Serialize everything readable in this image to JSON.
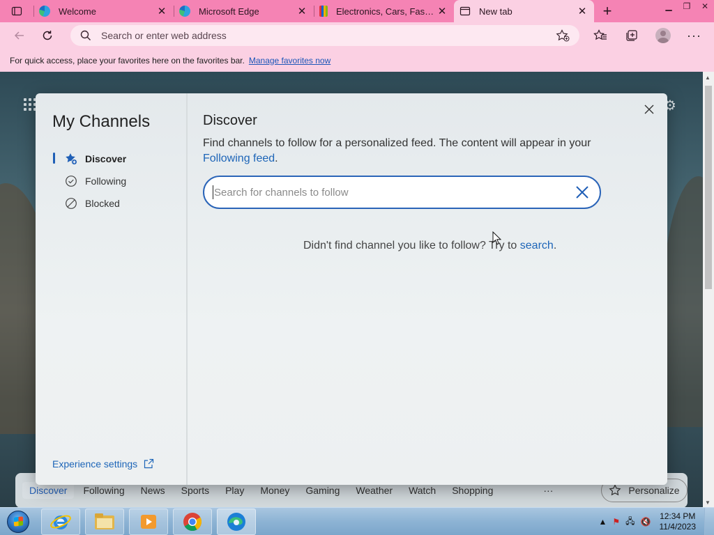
{
  "browser": {
    "tabs": [
      {
        "title": "Welcome",
        "icon": "edge-icon"
      },
      {
        "title": "Microsoft Edge",
        "icon": "edge-icon"
      },
      {
        "title": "Electronics, Cars, Fashion",
        "icon": "ebay-icon"
      },
      {
        "title": "New tab",
        "icon": "newtab-icon",
        "active": true
      }
    ],
    "address_placeholder": "Search or enter web address",
    "favorites_bar": {
      "message": "For quick access, place your favorites here on the favorites bar.",
      "link": "Manage favorites now"
    },
    "theme_color": "#f583b4"
  },
  "modal": {
    "title": "My Channels",
    "nav": [
      {
        "label": "Discover",
        "icon": "discover-star-icon",
        "active": true
      },
      {
        "label": "Following",
        "icon": "check-circle-icon"
      },
      {
        "label": "Blocked",
        "icon": "block-icon"
      }
    ],
    "experience_settings": "Experience settings",
    "heading": "Discover",
    "description": "Find channels to follow for a personalized feed. The content will appear in your",
    "description_link": "Following feed",
    "description_end": ".",
    "search_placeholder": "Search for channels to follow",
    "empty_message": "Didn't find channel you like to follow? Try to",
    "empty_link": "search",
    "empty_end": "."
  },
  "feed_nav": {
    "items": [
      "Discover",
      "Following",
      "News",
      "Sports",
      "Play",
      "Money",
      "Gaming",
      "Weather",
      "Watch",
      "Shopping"
    ],
    "more": "···",
    "personalize": "Personalize"
  },
  "taskbar": {
    "time": "12:34 PM",
    "date": "11/4/2023"
  }
}
